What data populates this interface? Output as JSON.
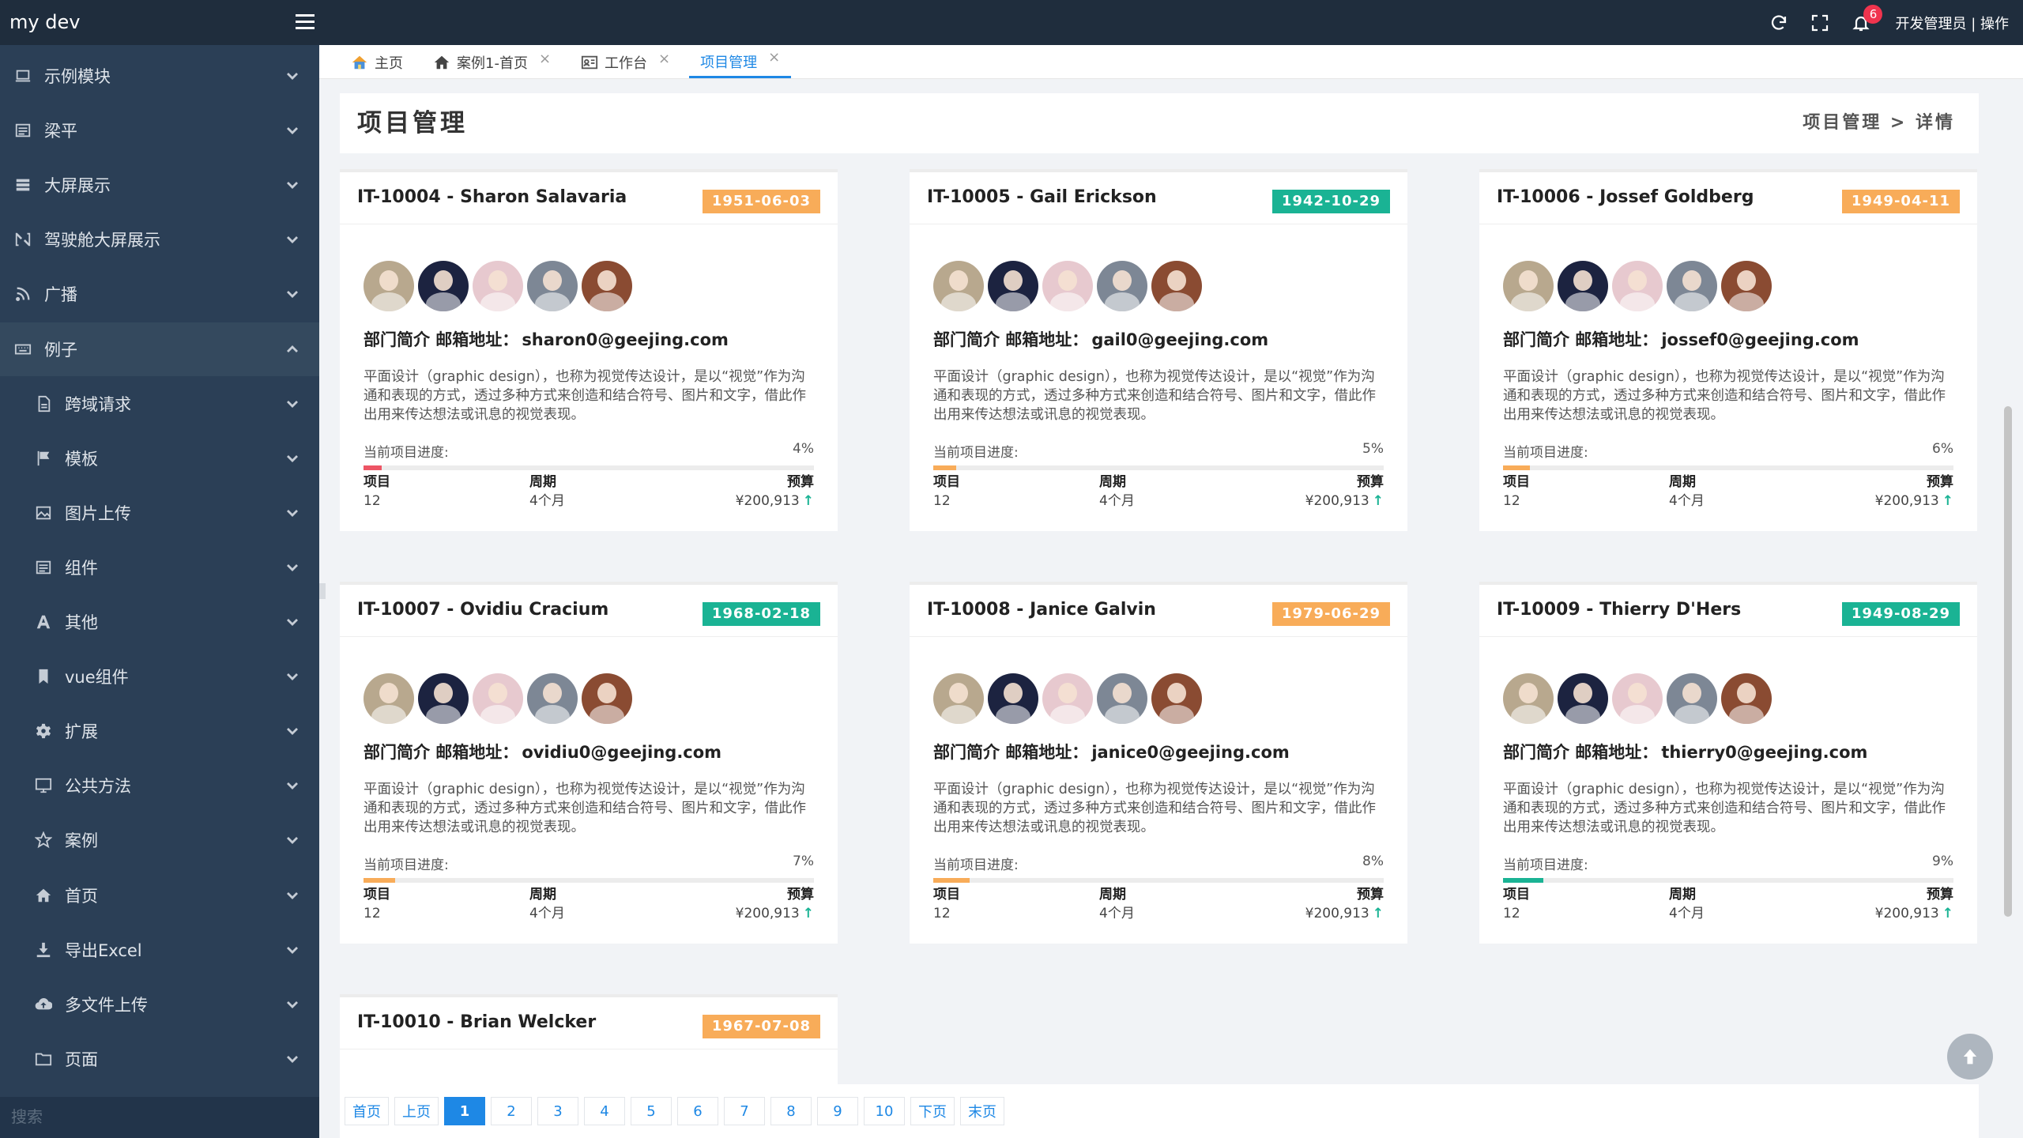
{
  "app": {
    "brand": "my dev"
  },
  "header": {
    "user_label": "开发管理员 | 操作",
    "notification_count": "6"
  },
  "sidebar": {
    "items": [
      {
        "label": "示例模块",
        "icon": "laptop-icon",
        "sub": false,
        "open": false
      },
      {
        "label": "梁平",
        "icon": "list-icon",
        "sub": false,
        "open": false
      },
      {
        "label": "大屏展示",
        "icon": "database-icon",
        "sub": false,
        "open": false
      },
      {
        "label": "驾驶舱大屏展示",
        "icon": "connect-icon",
        "sub": false,
        "open": false
      },
      {
        "label": "广播",
        "icon": "rss-icon",
        "sub": false,
        "open": false
      },
      {
        "label": "例子",
        "icon": "keyboard-icon",
        "sub": false,
        "open": true
      },
      {
        "label": "跨域请求",
        "icon": "document-icon",
        "sub": true,
        "open": false
      },
      {
        "label": "模板",
        "icon": "flag-icon",
        "sub": true,
        "open": false
      },
      {
        "label": "图片上传",
        "icon": "image-icon",
        "sub": true,
        "open": false
      },
      {
        "label": "组件",
        "icon": "list-icon",
        "sub": true,
        "open": false
      },
      {
        "label": "其他",
        "icon": "font-icon",
        "sub": true,
        "open": false
      },
      {
        "label": "vue组件",
        "icon": "bookmark-icon",
        "sub": true,
        "open": false
      },
      {
        "label": "扩展",
        "icon": "gear-icon",
        "sub": true,
        "open": false
      },
      {
        "label": "公共方法",
        "icon": "monitor-icon",
        "sub": true,
        "open": false
      },
      {
        "label": "案例",
        "icon": "star-icon",
        "sub": true,
        "open": false
      },
      {
        "label": "首页",
        "icon": "home-icon",
        "sub": true,
        "open": false
      },
      {
        "label": "导出Excel",
        "icon": "download-icon",
        "sub": true,
        "open": false
      },
      {
        "label": "多文件上传",
        "icon": "cloud-upload-icon",
        "sub": true,
        "open": false
      },
      {
        "label": "页面",
        "icon": "folder-icon",
        "sub": true,
        "open": false
      }
    ],
    "search_placeholder": "搜索"
  },
  "tabs": [
    {
      "label": "主页",
      "icon": "home-color-icon",
      "closable": false,
      "active": false
    },
    {
      "label": "案例1-首页",
      "icon": "home-icon",
      "closable": true,
      "active": false
    },
    {
      "label": "工作台",
      "icon": "id-card-icon",
      "closable": true,
      "active": false
    },
    {
      "label": "项目管理",
      "icon": "",
      "closable": true,
      "active": true
    }
  ],
  "page": {
    "title": "项目管理",
    "breadcrumb": "项目管理 > 详情"
  },
  "card_common": {
    "email_prefix": "部门简介 邮箱地址：",
    "description": "平面设计（graphic design），也称为视觉传达设计，是以“视觉”作为沟通和表现的方式，透过多种方式来创造和结合符号、图片和文字，借此作出用来传达想法或讯息的视觉表现。",
    "progress_label": "当前项目进度:",
    "stat_labels": [
      "项目",
      "周期",
      "预算"
    ],
    "stat_values": [
      "12",
      "4个月",
      "¥200,913"
    ]
  },
  "cards": [
    {
      "title": "IT-10004 - Sharon Salavaria",
      "date": "1951-06-03",
      "badge_color": "#f8ac59",
      "email": "sharon0@geejing.com",
      "progress": 4,
      "progress_text": "4%",
      "bar_color": "#ed5565"
    },
    {
      "title": "IT-10005 - Gail Erickson",
      "date": "1942-10-29",
      "badge_color": "#1ab394",
      "email": "gail0@geejing.com",
      "progress": 5,
      "progress_text": "5%",
      "bar_color": "#f8ac59"
    },
    {
      "title": "IT-10006 - Jossef Goldberg",
      "date": "1949-04-11",
      "badge_color": "#f8ac59",
      "email": "jossef0@geejing.com",
      "progress": 6,
      "progress_text": "6%",
      "bar_color": "#f8ac59"
    },
    {
      "title": "IT-10007 - Ovidiu Cracium",
      "date": "1968-02-18",
      "badge_color": "#1ab394",
      "email": "ovidiu0@geejing.com",
      "progress": 7,
      "progress_text": "7%",
      "bar_color": "#f8ac59"
    },
    {
      "title": "IT-10008 - Janice Galvin",
      "date": "1979-06-29",
      "badge_color": "#f8ac59",
      "email": "janice0@geejing.com",
      "progress": 8,
      "progress_text": "8%",
      "bar_color": "#f8ac59"
    },
    {
      "title": "IT-10009 - Thierry D'Hers",
      "date": "1949-08-29",
      "badge_color": "#1ab394",
      "email": "thierry0@geejing.com",
      "progress": 9,
      "progress_text": "9%",
      "bar_color": "#1ab394"
    },
    {
      "title": "IT-10010 - Brian Welcker",
      "date": "1967-07-08",
      "badge_color": "#f8ac59",
      "email": "",
      "progress": 0,
      "progress_text": "",
      "bar_color": "#f8ac59"
    }
  ],
  "avatar_colors": [
    "#b8a88e",
    "#1c2340",
    "#e7c9cf",
    "#7d8795",
    "#8a4b32"
  ],
  "pagination": {
    "first": "首页",
    "prev": "上页",
    "next": "下页",
    "last": "末页",
    "pages": [
      "1",
      "2",
      "3",
      "4",
      "5",
      "6",
      "7",
      "8",
      "9",
      "10"
    ],
    "current": "1"
  }
}
